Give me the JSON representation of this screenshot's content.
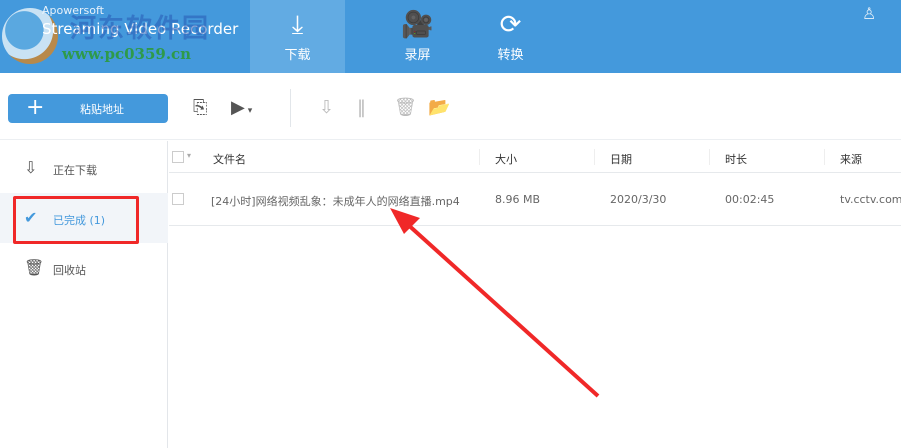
{
  "header": {
    "brand_line1": "Apowersoft",
    "brand_line2": "Streaming Video Recorder",
    "watermark_cn": "河东软件园",
    "watermark_url": "www.pc0359.cn",
    "tabs": [
      {
        "label": "下载",
        "active": true
      },
      {
        "label": "录屏",
        "active": false
      },
      {
        "label": "转换",
        "active": false
      }
    ]
  },
  "toolbar": {
    "paste_label": "粘贴地址"
  },
  "sidebar": {
    "items": [
      {
        "label": "正在下载"
      },
      {
        "label": "已完成 (1)",
        "active": true
      },
      {
        "label": "回收站"
      }
    ]
  },
  "table": {
    "columns": [
      "文件名",
      "大小",
      "日期",
      "时长",
      "来源"
    ],
    "rows": [
      {
        "name": "[24小时]网络视频乱象：未成年人的网络直播.mp4",
        "size": "8.96 MB",
        "date": "2020/3/30",
        "duration": "00:02:45",
        "source": "tv.cctv.com"
      }
    ]
  },
  "colors": {
    "accent": "#4499dc",
    "highlight": "#f02828"
  }
}
